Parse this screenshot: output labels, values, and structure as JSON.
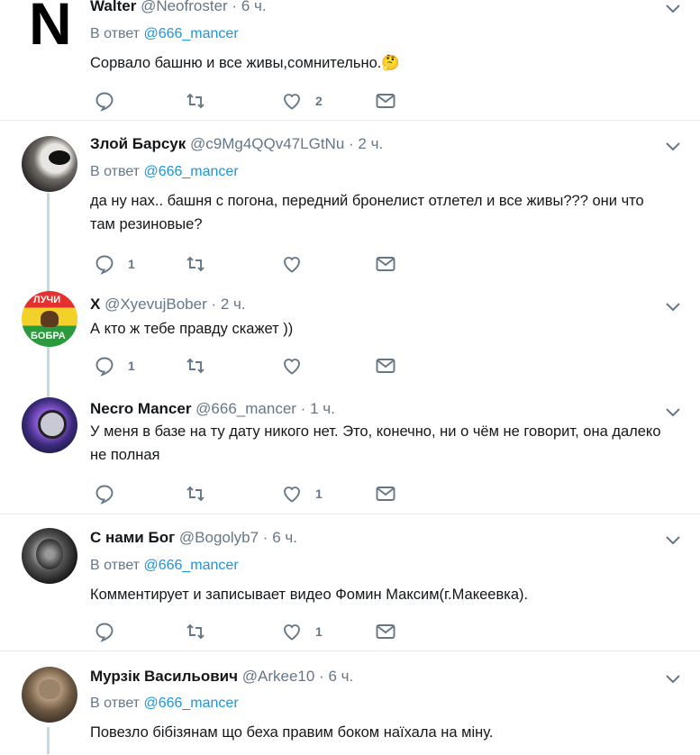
{
  "tweets": [
    {
      "name": "Walter",
      "handle": "@Neofroster",
      "time": "6 ч.",
      "reply_prefix": "В ответ",
      "reply_to": "@666_mancer",
      "text": "Сорвало башню и все живы,сомнительно.🤔",
      "replies": "",
      "likes": "2",
      "avatar_letter": "N"
    },
    {
      "name": "Злой Барсук",
      "handle": "@c9Mg4QQv47LGtNu",
      "time": "2 ч.",
      "reply_prefix": "В ответ",
      "reply_to": "@666_mancer",
      "text": "да ну нах.. башня с погона, передний бронелист отлетел и все живы??? они что там резиновые?",
      "replies": "1",
      "likes": ""
    },
    {
      "name": "X",
      "handle": "@XyevujBober",
      "time": "2 ч.",
      "text": "А кто ж тебе правду скажет ))",
      "replies": "1",
      "likes": "",
      "avatar_text_top": "ЛУЧИ",
      "avatar_text_bottom": "БОБРА"
    },
    {
      "name": "Necro Mancer",
      "handle": "@666_mancer",
      "time": "1 ч.",
      "text": "У меня в базе на ту дату никого нет. Это, конечно, ни о чём не говорит, она далеко не полная",
      "replies": "",
      "likes": "1"
    },
    {
      "name": "С нами Бог",
      "handle": "@Bogolyb7",
      "time": "6 ч.",
      "reply_prefix": "В ответ",
      "reply_to": "@666_mancer",
      "text": "Комментирует и записывает видео Фомин Максим(г.Макеевка).",
      "replies": "",
      "likes": "1"
    },
    {
      "name": "Мурзік Васильович",
      "handle": "@Arkee10",
      "time": "6 ч.",
      "reply_prefix": "В ответ",
      "reply_to": "@666_mancer",
      "text": "Повезло бібізянам що беха правим боком наїхала на міну.",
      "replies": "",
      "likes": ""
    }
  ],
  "separator": "·",
  "colors": {
    "accent": "#1b95e0",
    "muted": "#657786",
    "line": "#ccd6dd"
  }
}
